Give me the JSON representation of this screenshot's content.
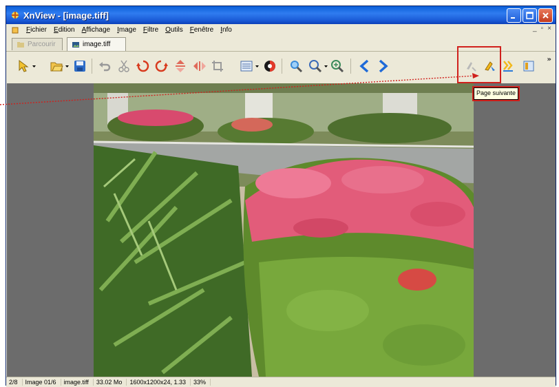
{
  "window": {
    "title": "XnView - [image.tiff]",
    "mdi_controls": [
      "_",
      "▫",
      "×"
    ]
  },
  "menu": {
    "items": [
      "Fichier",
      "Edition",
      "Affichage",
      "Image",
      "Filtre",
      "Outils",
      "Fenêtre",
      "Info"
    ]
  },
  "tabs": [
    {
      "label": "Parcourir",
      "active": false
    },
    {
      "label": "image.tiff",
      "active": true
    }
  ],
  "toolbar": {
    "icons": [
      "select-icon",
      "open-folder-icon",
      "save-icon",
      "undo-icon",
      "cut-icon",
      "rotate-left-icon",
      "rotate-right-icon",
      "flip-vertical-icon",
      "flip-horizontal-icon",
      "crop-icon",
      "adjust-icon",
      "color-icon",
      "zoom-in-icon",
      "zoom-icon",
      "zoom-fit-icon",
      "previous-icon",
      "next-icon",
      "first-page-icon",
      "next-page-icon",
      "last-page-icon",
      "fullscreen-icon"
    ],
    "more": "»"
  },
  "tooltip": {
    "text": "Page suivante"
  },
  "status": {
    "page": "2/8",
    "image_index": "Image 01/6",
    "filename": "image.tiff",
    "size": "33.02 Mo",
    "dimensions": "1600x1200x24, 1.33",
    "zoom": "33%"
  },
  "colors": {
    "titlebar": "#1a5ad6",
    "highlight": "#d0201c",
    "viewer_bg": "#6c6c6c"
  }
}
